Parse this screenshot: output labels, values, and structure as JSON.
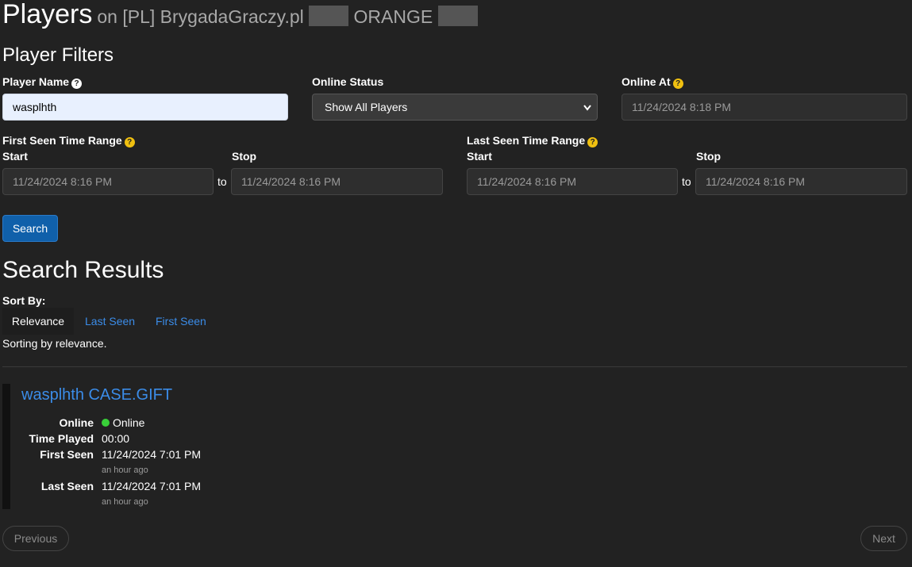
{
  "header": {
    "title": "Players",
    "server_prefix": "on [PL] BrygadaGraczy.pl",
    "server_suffix": "ORANGE"
  },
  "filters": {
    "section_title": "Player Filters",
    "player_name": {
      "label": "Player Name",
      "value": "wasplhth"
    },
    "online_status": {
      "label": "Online Status",
      "selected": "Show All Players"
    },
    "online_at": {
      "label": "Online At",
      "value": "11/24/2024 8:18 PM"
    },
    "first_seen": {
      "label": "First Seen Time Range",
      "start_label": "Start",
      "stop_label": "Stop",
      "start_value": "11/24/2024 8:16 PM",
      "stop_value": "11/24/2024 8:16 PM",
      "separator": "to"
    },
    "last_seen": {
      "label": "Last Seen Time Range",
      "start_label": "Start",
      "stop_label": "Stop",
      "start_value": "11/24/2024 8:16 PM",
      "stop_value": "11/24/2024 8:16 PM",
      "separator": "to"
    },
    "search_label": "Search",
    "help_glyph": "?"
  },
  "results": {
    "title": "Search Results",
    "sort_by_label": "Sort By:",
    "sort_options": [
      "Relevance",
      "Last Seen",
      "First Seen"
    ],
    "sort_status": "Sorting by relevance.",
    "players": [
      {
        "name": "wasplhth CASE.GIFT",
        "online_label": "Online",
        "online_value": "Online",
        "time_played_label": "Time Played",
        "time_played_value": "00:00",
        "first_seen_label": "First Seen",
        "first_seen_value": "11/24/2024 7:01 PM",
        "first_seen_ago": "an hour ago",
        "last_seen_label": "Last Seen",
        "last_seen_value": "11/24/2024 7:01 PM",
        "last_seen_ago": "an hour ago"
      }
    ]
  },
  "pagination": {
    "previous_label": "Previous",
    "next_label": "Next"
  },
  "colors": {
    "background": "#222222",
    "link": "#3b8ce8",
    "primary_button": "#1060aa",
    "online": "#39d039",
    "help_yellow": "#f0c010"
  }
}
